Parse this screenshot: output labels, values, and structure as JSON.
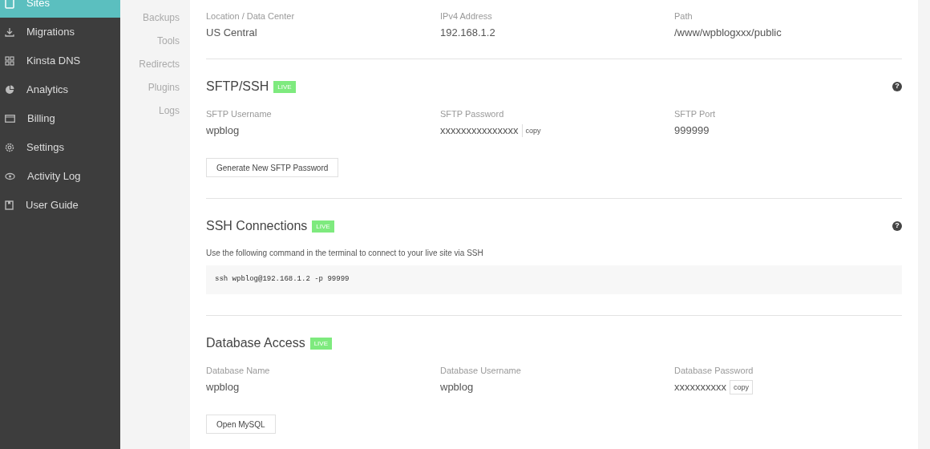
{
  "sidebar": {
    "items": [
      {
        "label": "Sites",
        "selected": true
      },
      {
        "label": "Migrations",
        "selected": false
      },
      {
        "label": "Kinsta DNS",
        "selected": false
      },
      {
        "label": "Analytics",
        "selected": false
      },
      {
        "label": "Billing",
        "selected": false
      },
      {
        "label": "Settings",
        "selected": false
      },
      {
        "label": "Activity Log",
        "selected": false
      },
      {
        "label": "User Guide",
        "selected": false
      }
    ]
  },
  "subnav": {
    "items": [
      "Backups",
      "Tools",
      "Redirects",
      "Plugins",
      "Logs"
    ]
  },
  "sections": [
    {
      "fields": [
        {
          "label": "Location / Data Center",
          "value": "US Central"
        },
        {
          "label": "IPv4 Address",
          "value": "192.168.1.2"
        },
        {
          "label": "Path",
          "value": "/www/wpblogxxx/public"
        }
      ]
    },
    {
      "title": "SFTP/SSH",
      "badge": "LIVE",
      "help": "?",
      "fields": [
        {
          "label": "SFTP Username",
          "value": "wpblog"
        },
        {
          "label": "SFTP Password",
          "value": "xxxxxxxxxxxxxxx",
          "copy": "copy"
        },
        {
          "label": "SFTP Port",
          "value": "999999"
        }
      ],
      "button": "Generate New SFTP Password"
    },
    {
      "title": "SSH Connections",
      "badge": "LIVE",
      "help": "?",
      "description": "Use the following command in the terminal to connect to your live site via SSH",
      "code": "ssh wpblog@192.168.1.2 -p 99999"
    },
    {
      "title": "Database Access",
      "badge": "LIVE",
      "fields": [
        {
          "label": "Database Name",
          "value": "wpblog"
        },
        {
          "label": "Database Username",
          "value": "wpblog"
        },
        {
          "label": "Database Password",
          "value": "xxxxxxxxxx",
          "copy": "copy",
          "boxed": true
        }
      ],
      "button": "Open MySQL"
    }
  ]
}
